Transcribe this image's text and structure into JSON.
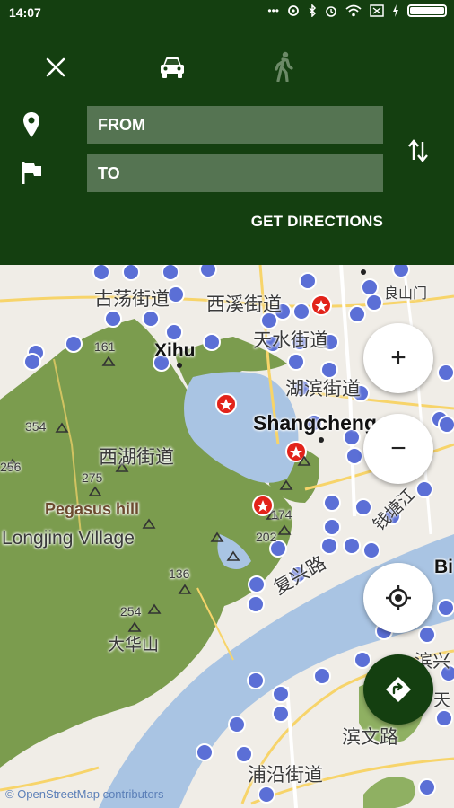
{
  "status": {
    "time": "14:07",
    "dots": "•••",
    "battery_level": 1.0
  },
  "toolbar": {
    "close_icon": "close-icon",
    "drive_icon": "car-icon",
    "walk_icon": "walk-icon"
  },
  "route": {
    "from_placeholder": "FROM",
    "to_placeholder": "TO",
    "get_directions_label": "GET DIRECTIONS"
  },
  "map": {
    "labels": [
      {
        "text": "古荡街道"
      },
      {
        "text": "西溪街道"
      },
      {
        "text": "良山门"
      },
      {
        "text": "Xihu"
      },
      {
        "text": "天水街道"
      },
      {
        "text": "湖滨街道"
      },
      {
        "text": "Shangcheng"
      },
      {
        "text": "西湖街道"
      },
      {
        "text": "Pegasus hill"
      },
      {
        "text": "Longjing Village"
      },
      {
        "text": "复兴路"
      },
      {
        "text": "钱塘江"
      },
      {
        "text": "大华山"
      },
      {
        "text": "滨文路"
      },
      {
        "text": "浦沿街道"
      },
      {
        "text": "滨兴"
      },
      {
        "text": "Bi"
      },
      {
        "text": "天"
      }
    ],
    "peaks": [
      {
        "value": "161"
      },
      {
        "value": "354"
      },
      {
        "value": "256"
      },
      {
        "value": "275"
      },
      {
        "value": "174"
      },
      {
        "value": "202"
      },
      {
        "value": "136"
      },
      {
        "value": "254"
      }
    ],
    "attribution": "© OpenStreetMap contributors"
  },
  "controls": {
    "zoom_in": "+",
    "zoom_out": "−"
  },
  "colors": {
    "header": "#143f10",
    "forest": "#6f9545",
    "water": "#a9c4e3",
    "transit": "#5b6fd6",
    "poi_red": "#e2231a"
  }
}
